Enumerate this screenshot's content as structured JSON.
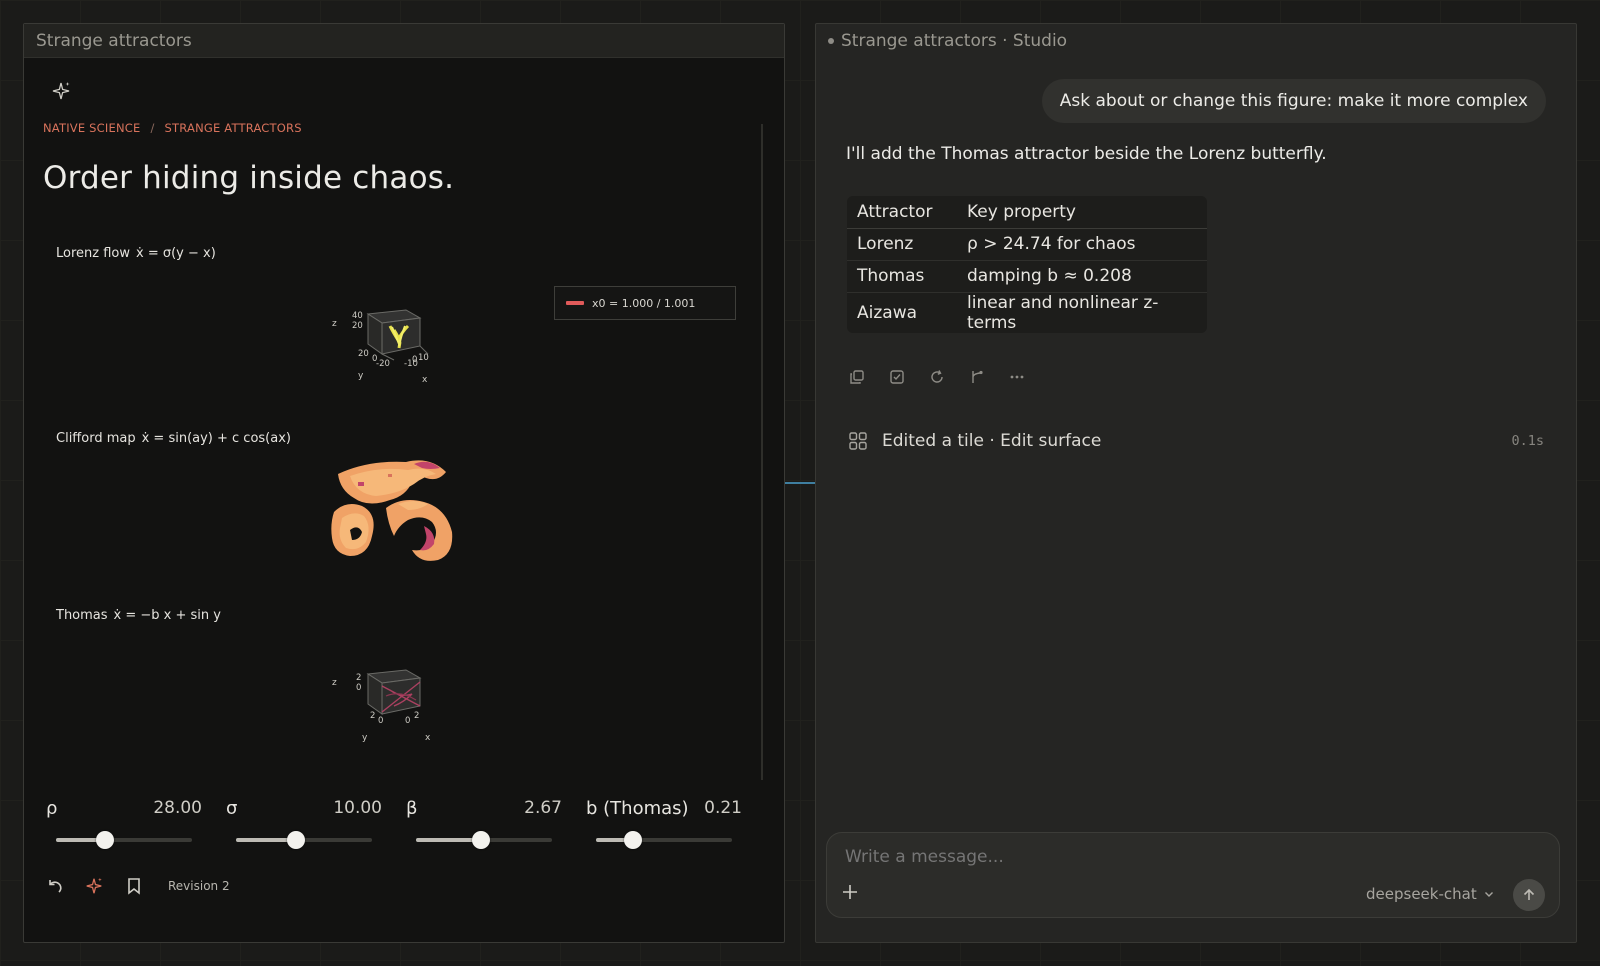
{
  "left_panel": {
    "window_title": "Strange attractors",
    "breadcrumb": [
      "NATIVE SCIENCE",
      "/",
      "STRANGE ATTRACTORS"
    ],
    "headline": "Order hiding inside chaos.",
    "tiles": [
      {
        "name": "Lorenz flow",
        "equation": "ẋ = σ(y − x)"
      },
      {
        "name": "Clifford map",
        "equation": "ẋ = sin(ay) + c cos(ax)"
      },
      {
        "name": "Thomas",
        "equation": "ẋ = −b x + sin y"
      }
    ],
    "legend_label": "x0 = 1.000 / 1.001",
    "lorenz_axes": {
      "z_ticks": [
        "40",
        "20"
      ],
      "y_ticks": [
        "20",
        "0",
        "-20"
      ],
      "x_ticks": [
        "-10",
        "0",
        "10"
      ],
      "z_label": "z",
      "y_label": "y",
      "x_label": "x"
    },
    "thomas_axes": {
      "z_ticks": [
        "2",
        "0"
      ],
      "y_ticks": [
        "2",
        "0"
      ],
      "x_ticks": [
        "0",
        "2"
      ],
      "z_label": "z",
      "y_label": "y",
      "x_label": "x"
    },
    "sliders": [
      {
        "label": "ρ",
        "value": "28.00",
        "fraction": 0.36
      },
      {
        "label": "σ",
        "value": "10.00",
        "fraction": 0.44
      },
      {
        "label": "β",
        "value": "2.67",
        "fraction": 0.48
      },
      {
        "label": "b (Thomas)",
        "value": "0.21",
        "fraction": 0.27
      }
    ],
    "revision": "Revision 2"
  },
  "right_panel": {
    "window_title": "Strange attractors · Studio",
    "user_message": "Ask about or change this figure: make it more complex",
    "assistant_message": "I'll add the Thomas attractor beside the Lorenz butterfly.",
    "table": {
      "headers": [
        "Attractor",
        "Key property"
      ],
      "rows": [
        [
          "Lorenz",
          "ρ > 24.74 for chaos"
        ],
        [
          "Thomas",
          "damping b ≈ 0.208"
        ],
        [
          "Aizawa",
          "linear and nonlinear z-terms"
        ]
      ]
    },
    "edit_status": "Edited a tile · Edit surface",
    "edit_time": "0.1s",
    "composer_placeholder": "Write a message...",
    "model_name": "deepseek-chat"
  },
  "colors": {
    "accent": "#d9735c",
    "legend_series": "#e05a5a",
    "connector": "#3f7fa0"
  }
}
